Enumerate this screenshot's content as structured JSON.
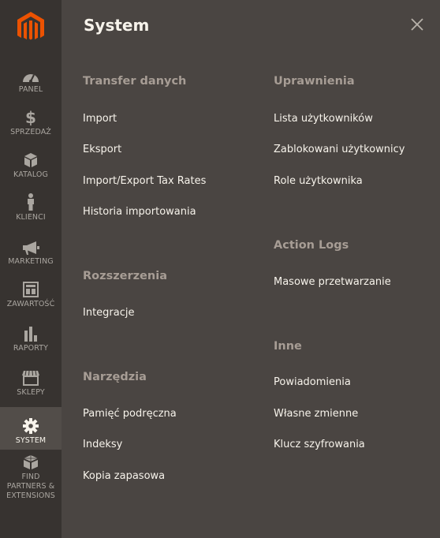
{
  "sidebar": {
    "logo": "magento-logo",
    "items": [
      {
        "label": "PANEL",
        "icon": "dashboard-icon"
      },
      {
        "label": "SPRZEDAŻ",
        "icon": "dollar-icon"
      },
      {
        "label": "KATALOG",
        "icon": "box-icon"
      },
      {
        "label": "KLIENCI",
        "icon": "person-icon"
      },
      {
        "label": "MARKETING",
        "icon": "megaphone-icon"
      },
      {
        "label": "ZAWARTOŚĆ",
        "icon": "layout-icon"
      },
      {
        "label": "RAPORTY",
        "icon": "bar-chart-icon"
      },
      {
        "label": "SKLEPY",
        "icon": "store-icon"
      },
      {
        "label": "SYSTEM",
        "icon": "gear-icon",
        "active": true
      },
      {
        "label": "FIND PARTNERS & EXTENSIONS",
        "icon": "cubes-icon"
      }
    ]
  },
  "panel": {
    "title": "System",
    "close_icon": "close-icon",
    "left_sections": [
      {
        "title": "Transfer danych",
        "links": [
          "Import",
          "Eksport",
          "Import/Export Tax Rates",
          "Historia importowania"
        ]
      },
      {
        "title": "Rozszerzenia",
        "links": [
          "Integracje"
        ]
      },
      {
        "title": "Narzędzia",
        "links": [
          "Pamięć podręczna",
          "Indeksy",
          "Kopia zapasowa"
        ]
      }
    ],
    "right_sections": [
      {
        "title": "Uprawnienia",
        "links": [
          "Lista użytkowników",
          "Zablokowani użytkownicy",
          "Role użytkownika"
        ]
      },
      {
        "title": "Action Logs",
        "links": [
          "Masowe przetwarzanie"
        ]
      },
      {
        "title": "Inne",
        "links": [
          "Powiadomienia",
          "Własne zmienne",
          "Klucz szyfrowania"
        ]
      }
    ]
  },
  "colors": {
    "sidebar_bg": "#373330",
    "panel_bg": "#4a4542",
    "active_bg": "#524d49",
    "logo_orange": "#eb5202",
    "section_title": "#a79d95",
    "link_text": "#f7f3eb"
  }
}
